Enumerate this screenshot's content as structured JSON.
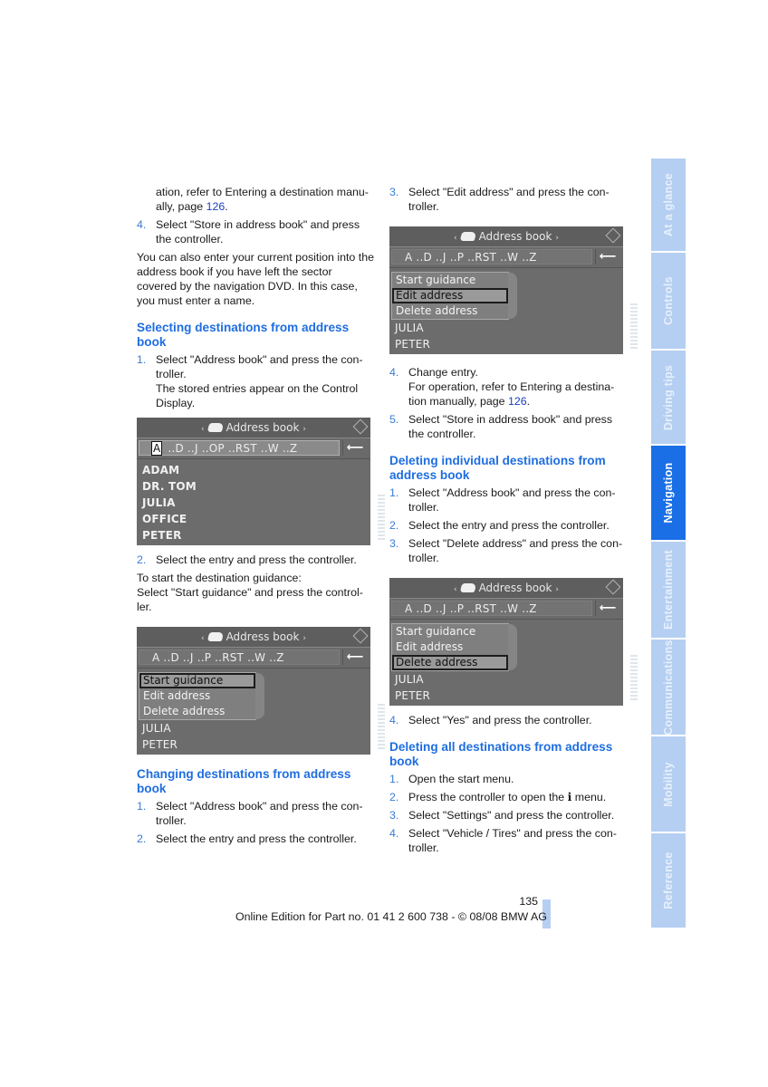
{
  "left": {
    "cont_text_pre": "ation, refer to Entering a destination manu-ally, page ",
    "cont_link": "126",
    "cont_text_post": ".",
    "step4": {
      "num": "4.",
      "text": "Select \"Store in address book\" and press the controller."
    },
    "para": "You can also enter your current position into the address book if you have left the sector covered by the navigation DVD. In this case, you must enter a name.",
    "h_selecting": "Selecting destinations from address book",
    "sel_step1": {
      "num": "1.",
      "text": "Select \"Address book\" and press the con-troller.",
      "sub": "The stored entries appear on the Control Display."
    },
    "sel_step2": {
      "num": "2.",
      "text": "Select the entry and press the controller."
    },
    "guidance_intro": "To start the destination guidance:",
    "guidance_text": "Select \"Start guidance\" and press the control-ler.",
    "h_changing": "Changing destinations from address book",
    "chg_step1": {
      "num": "1.",
      "text": "Select \"Address book\" and press the con-troller."
    },
    "chg_step2": {
      "num": "2.",
      "text": "Select the entry and press the controller."
    }
  },
  "right": {
    "step3": {
      "num": "3.",
      "text": "Select \"Edit address\" and press the con-troller."
    },
    "step4": {
      "num": "4.",
      "text": "Change entry.",
      "sub_pre": "For operation, refer to Entering a destina-tion manually, page ",
      "sub_link": "126",
      "sub_post": "."
    },
    "step5": {
      "num": "5.",
      "text": "Select \"Store in address book\" and press the controller."
    },
    "h_deleting_ind": "Deleting individual destinations from address book",
    "del_step1": {
      "num": "1.",
      "text": "Select \"Address book\" and press the con-troller."
    },
    "del_step2": {
      "num": "2.",
      "text": "Select the entry and press the controller."
    },
    "del_step3": {
      "num": "3.",
      "text": "Select \"Delete address\" and press the con-troller."
    },
    "del_step4": {
      "num": "4.",
      "text": "Select \"Yes\" and press the controller."
    },
    "h_deleting_all": "Deleting all destinations from address book",
    "all_step1": {
      "num": "1.",
      "text": "Open the start menu."
    },
    "all_step2": {
      "num": "2.",
      "text_pre": "Press the controller to open the ",
      "icon": "i",
      "text_post": " menu."
    },
    "all_step3": {
      "num": "3.",
      "text": "Select \"Settings\" and press the controller."
    },
    "all_step4": {
      "num": "4.",
      "text": "Select \"Vehicle / Tires\" and press the con-troller."
    }
  },
  "screens": {
    "title": "Address book",
    "arrow_left": "‹",
    "arrow_right": "›",
    "back_icon": "⟵",
    "s1": {
      "cursor": "A",
      "alpha": " ..D ..J ..OP ..RST ..W ..Z",
      "entries": [
        "ADAM",
        "DR. TOM",
        "JULIA",
        "OFFICE",
        "PETER"
      ]
    },
    "alpha": "A ..D ..J ..P ..RST ..W ..Z",
    "popup_options": [
      "Start guidance",
      "Edit address",
      "Delete address"
    ],
    "popup_entries": [
      "JULIA",
      "PETER"
    ]
  },
  "tabs": [
    {
      "label": "At a glance",
      "active": false
    },
    {
      "label": "Controls",
      "active": false
    },
    {
      "label": "Driving tips",
      "active": false
    },
    {
      "label": "Navigation",
      "active": true
    },
    {
      "label": "Entertainment",
      "active": false
    },
    {
      "label": "Communications",
      "active": false
    },
    {
      "label": "Mobility",
      "active": false
    },
    {
      "label": "Reference",
      "active": false
    }
  ],
  "footer": {
    "page_number": "135",
    "text": "Online Edition for Part no. 01 41 2 600 738 - © 08/08 BMW AG"
  }
}
